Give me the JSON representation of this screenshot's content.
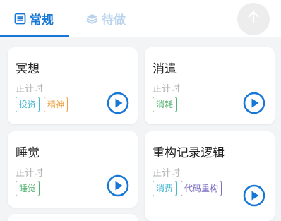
{
  "tabs": {
    "regular": {
      "label": "常规",
      "icon": "list-icon"
    },
    "todo": {
      "label": "待做",
      "icon": "layers-icon"
    }
  },
  "scroll_top_icon": "arrow-up-icon",
  "colors": {
    "accent": "#1677d6",
    "tab_inactive": "#b9d3ec",
    "tag_teal": "#45b7cf",
    "tag_orange": "#f0a040",
    "tag_green": "#52b372",
    "tag_purple": "#7a6cc0"
  },
  "cards": [
    {
      "title": "冥想",
      "type": "正计时",
      "tags": [
        {
          "label": "投资",
          "color": "teal"
        },
        {
          "label": "精神",
          "color": "orange"
        }
      ]
    },
    {
      "title": "消遣",
      "type": "正计时",
      "tags": [
        {
          "label": "消耗",
          "color": "green"
        }
      ]
    },
    {
      "title": "睡觉",
      "type": "正计时",
      "tags": [
        {
          "label": "睡觉",
          "color": "green"
        }
      ]
    },
    {
      "title": "重构记录逻辑",
      "type": "正计时",
      "tags": [
        {
          "label": "消费",
          "color": "teal"
        },
        {
          "label": "代码重构",
          "color": "purple"
        }
      ]
    }
  ]
}
